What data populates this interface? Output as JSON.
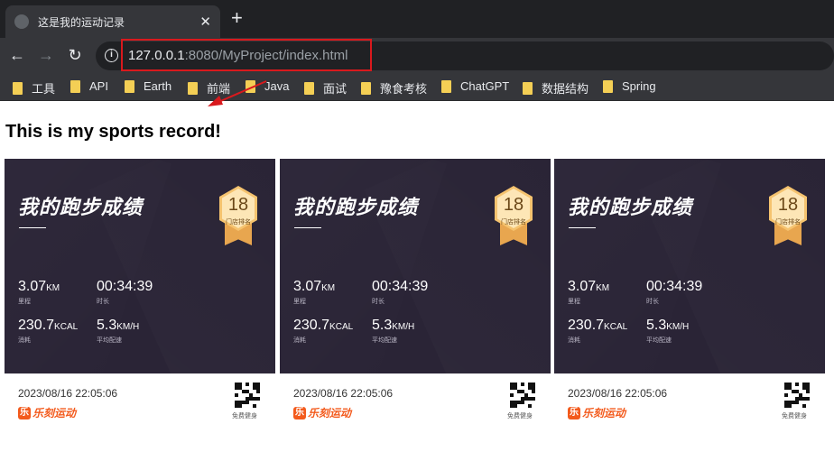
{
  "browser": {
    "tab_title": "这是我的运动记录",
    "tab_close": "✕",
    "new_tab": "+",
    "back": "←",
    "forward": "→",
    "reload": "↻",
    "info": "i",
    "url_host": "127.0.0.1",
    "url_rest": ":8080/MyProject/index.html",
    "bookmarks": [
      "工具",
      "API",
      "Earth",
      "前端",
      "Java",
      "面试",
      "豫食考核",
      "ChatGPT",
      "数据结构",
      "Spring"
    ]
  },
  "page": {
    "title": "This is my sports record!"
  },
  "card": {
    "heading": "我的跑步成绩",
    "rank": "18",
    "rank_label": "门店排名",
    "distance_value": "3.07",
    "distance_unit": "KM",
    "distance_label": "里程",
    "duration_value": "00:34:39",
    "duration_label": "时长",
    "calories_value": "230.7",
    "calories_unit": "KCAL",
    "calories_label": "消耗",
    "speed_value": "5.3",
    "speed_unit": "KM/H",
    "speed_label": "平均配速",
    "date": "2023/08/16 22:05:06",
    "brand_mark": "乐",
    "brand": "乐刻运动",
    "qr_label": "免费健身"
  },
  "colors": {
    "panel_bg": "#2a2436",
    "brand": "#f35a1c",
    "highlight_box": "#d9191d"
  }
}
